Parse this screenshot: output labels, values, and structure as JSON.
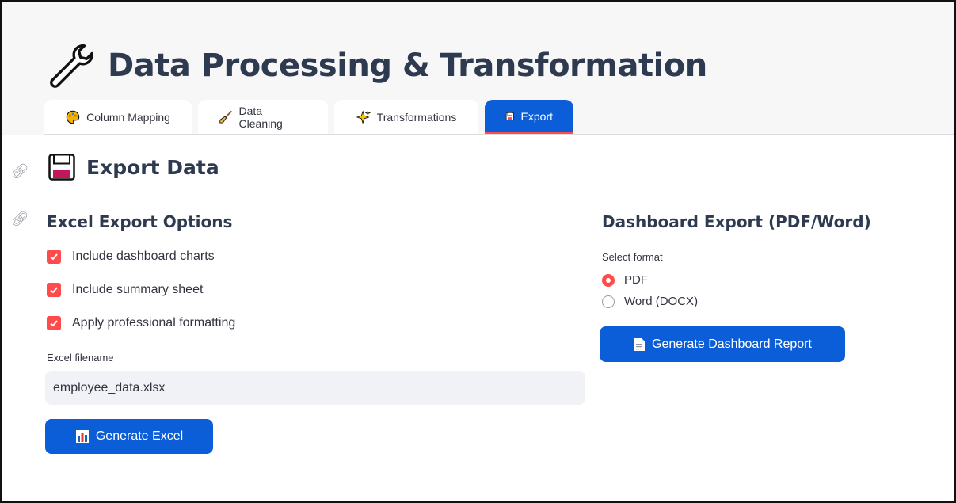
{
  "page": {
    "title": "Data Processing & Transformation",
    "title_icon": "wrench-icon"
  },
  "tabs": [
    {
      "label": "Column Mapping",
      "icon": "palette-icon",
      "active": false
    },
    {
      "label": "Data Cleaning",
      "icon": "broom-icon",
      "active": false
    },
    {
      "label": "Transformations",
      "icon": "sparkles-icon",
      "active": false
    },
    {
      "label": "Export",
      "icon": "floppy-disk-icon",
      "active": true
    }
  ],
  "section": {
    "title": "Export Data",
    "icon": "floppy-disk-icon"
  },
  "excel": {
    "heading": "Excel Export Options",
    "options": [
      {
        "label": "Include dashboard charts",
        "checked": true
      },
      {
        "label": "Include summary sheet",
        "checked": true
      },
      {
        "label": "Apply professional formatting",
        "checked": true
      }
    ],
    "filename_label": "Excel filename",
    "filename_value": "employee_data.xlsx",
    "button_label": "Generate Excel",
    "button_icon": "bar-chart-icon"
  },
  "dashboard": {
    "heading": "Dashboard Export (PDF/Word)",
    "format_label": "Select format",
    "formats": [
      {
        "label": "PDF",
        "selected": true
      },
      {
        "label": "Word (DOCX)",
        "selected": false
      }
    ],
    "button_label": "Generate Dashboard Report",
    "button_icon": "document-icon"
  },
  "colors": {
    "primary": "#0b5ed7",
    "accent": "#ff4b4b",
    "heading": "#2e3a4f",
    "input_bg": "#f0f2f6"
  }
}
